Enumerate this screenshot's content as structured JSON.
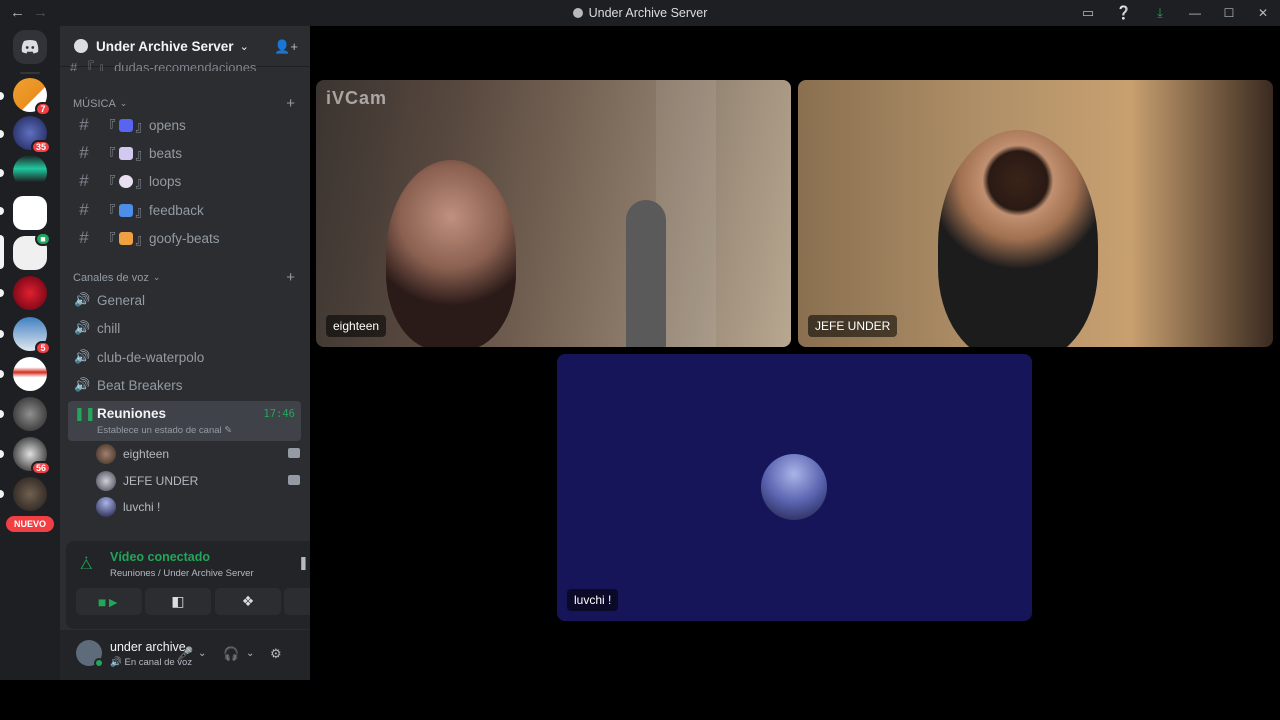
{
  "window": {
    "title": "Under Archive Server"
  },
  "rail": {
    "servers": [
      {
        "badge": "7"
      },
      {
        "badge": "35"
      },
      {
        "badge": ""
      },
      {
        "badge": ""
      },
      {
        "badge": ""
      },
      {
        "badge": ""
      },
      {
        "badge": "5"
      },
      {
        "badge": ""
      },
      {
        "badge": ""
      },
      {
        "badge": "56"
      },
      {
        "badge": ""
      }
    ],
    "new_label": "NUEVO"
  },
  "sidebar": {
    "server_name": "Under Archive Server",
    "cut_channel": "# 『 』 dudas-recomendaciones",
    "category_music": "MÚSICA",
    "text_channels": [
      {
        "name": "opens",
        "emoji_color": "#5865f2"
      },
      {
        "name": "beats",
        "emoji_color": "#d2c8f0"
      },
      {
        "name": "loops",
        "emoji_color": "#e8e0f0"
      },
      {
        "name": "feedback",
        "emoji_color": "#4d8ee8"
      },
      {
        "name": "goofy-beats",
        "emoji_color": "#f0a040"
      }
    ],
    "category_voice": "Canales de voz",
    "voice_channels": [
      {
        "name": "General"
      },
      {
        "name": "chill"
      },
      {
        "name": "club-de-waterpolo"
      },
      {
        "name": "Beat Breakers"
      }
    ],
    "active_channel": {
      "name": "Reuniones",
      "status": "Establece un estado de canal",
      "time": "17:46"
    },
    "voice_users": [
      {
        "name": "eighteen",
        "camera": true
      },
      {
        "name": "JEFE UNDER",
        "camera": true
      },
      {
        "name": "luvchi !",
        "camera": false
      }
    ]
  },
  "voice_panel": {
    "title": "Vídeo conectado",
    "subtitle": "Reuniones / Under Archive Server"
  },
  "user_panel": {
    "name": "under archive",
    "status": "En canal de voz"
  },
  "stage": {
    "watermark": "iVCam",
    "tiles": [
      {
        "name": "eighteen"
      },
      {
        "name": "JEFE UNDER"
      },
      {
        "name": "luvchi !"
      }
    ]
  },
  "colors": {
    "green": "#23a55a",
    "accent": "#5865f2",
    "danger": "#f23f43"
  }
}
